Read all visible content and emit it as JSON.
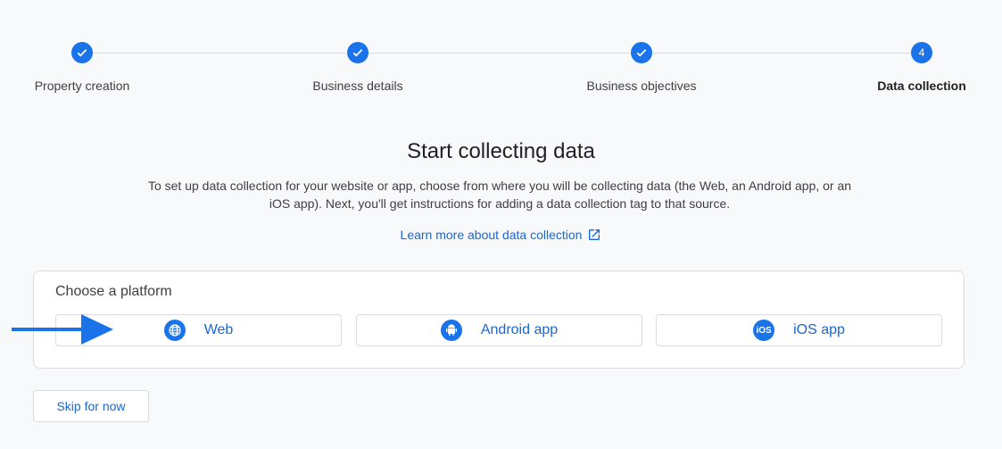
{
  "stepper": {
    "steps": [
      {
        "label": "Property creation",
        "state": "complete",
        "icon": "check-icon"
      },
      {
        "label": "Business details",
        "state": "complete",
        "icon": "check-icon"
      },
      {
        "label": "Business objectives",
        "state": "complete",
        "icon": "check-icon"
      },
      {
        "label": "Data collection",
        "state": "active",
        "number": "4"
      }
    ]
  },
  "main": {
    "title": "Start collecting data",
    "description": "To set up data collection for your website or app, choose from where you will be collecting data (the Web, an Android app, or an iOS app). Next, you'll get instructions for adding a data collection tag to that source.",
    "learn_more": "Learn more about data collection",
    "learn_more_icon": "external-link-icon"
  },
  "platform_card": {
    "title": "Choose a platform",
    "options": [
      {
        "label": "Web",
        "icon": "globe-icon"
      },
      {
        "label": "Android app",
        "icon": "android-icon"
      },
      {
        "label": "iOS app",
        "icon": "ios-icon",
        "icon_text": "iOS"
      }
    ]
  },
  "annotation": {
    "icon": "arrow-right-icon",
    "color": "#1a73e8"
  },
  "footer": {
    "skip_label": "Skip for now"
  },
  "colors": {
    "accent": "#1a73e8",
    "link": "#1967d2",
    "border": "#dadce0",
    "background": "#f8f9fa"
  }
}
